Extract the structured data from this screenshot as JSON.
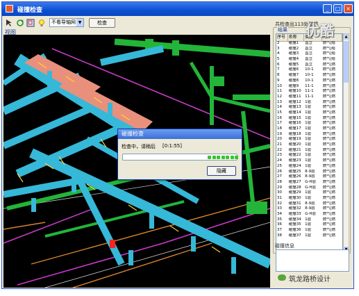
{
  "window": {
    "title": "碰撞检查",
    "minimize": "_",
    "maximize": "□",
    "close": "×"
  },
  "toolbar": {
    "select_value": "不看导轴网",
    "button_label": "检查",
    "view_label": "视图"
  },
  "dialog": {
    "title": "碰撞检查",
    "message": "检查中，请稍后",
    "elapsed": "[0:1:55]",
    "progress_blocks": 7,
    "button_label": "隐藏"
  },
  "results_panel": {
    "title": "共检查出113处碰撞",
    "group_label": "结果",
    "columns": [
      "序号",
      "名称",
      "类型",
      "构件"
    ],
    "rows": [
      [
        "2",
        "碰撞1",
        "直立",
        "燃气|给"
      ],
      [
        "3",
        "碰撞2",
        "直立",
        "燃气|给"
      ],
      [
        "4",
        "碰撞3",
        "直立",
        "燃气|给"
      ],
      [
        "5",
        "碰撞4",
        "直立",
        "燃气|给"
      ],
      [
        "6",
        "碰撞5",
        "直立",
        "燃气|燃"
      ],
      [
        "7",
        "碰撞6",
        "10-1",
        "燃气|燃"
      ],
      [
        "8",
        "碰撞7",
        "10-1",
        "燃气|燃"
      ],
      [
        "9",
        "碰撞8",
        "10-1",
        "燃气|燃"
      ],
      [
        "10",
        "碰撞9",
        "11-1",
        "燃气|燃"
      ],
      [
        "11",
        "碰撞10",
        "11-1",
        "燃气|燃"
      ],
      [
        "12",
        "碰撞11",
        "11-1",
        "燃气|燃"
      ],
      [
        "13",
        "碰撞12",
        "1层",
        "燃气|燃"
      ],
      [
        "14",
        "碰撞13",
        "1层",
        "燃气|燃"
      ],
      [
        "15",
        "碰撞14",
        "1层",
        "燃气|燃"
      ],
      [
        "16",
        "碰撞15",
        "1层",
        "燃气|燃"
      ],
      [
        "17",
        "碰撞16",
        "1层",
        "燃气|燃"
      ],
      [
        "18",
        "碰撞17",
        "1层",
        "燃气|燃"
      ],
      [
        "19",
        "碰撞18",
        "1层",
        "燃气|燃"
      ],
      [
        "20",
        "碰撞19",
        "1层",
        "燃气|燃"
      ],
      [
        "21",
        "碰撞20",
        "1层",
        "燃气|燃"
      ],
      [
        "22",
        "碰撞21",
        "1层",
        "燃气|燃"
      ],
      [
        "23",
        "碰撞22",
        "1层",
        "燃气|燃"
      ],
      [
        "24",
        "碰撞23",
        "1层",
        "燃气|燃"
      ],
      [
        "25",
        "碰撞24",
        "1层",
        "燃气|燃"
      ],
      [
        "26",
        "碰撞25",
        "8-9层",
        "燃气|燃"
      ],
      [
        "27",
        "碰撞26",
        "8-9层",
        "燃气|燃"
      ],
      [
        "28",
        "碰撞27",
        "G-H层",
        "燃气|燃"
      ],
      [
        "29",
        "碰撞28",
        "G-H层",
        "燃气|燃"
      ],
      [
        "30",
        "碰撞29",
        "1层",
        "燃气|燃"
      ],
      [
        "31",
        "碰撞30",
        "1层",
        "燃气|燃"
      ],
      [
        "32",
        "碰撞31",
        "8-9层",
        "燃气|燃"
      ],
      [
        "33",
        "碰撞32",
        "8-9层",
        "燃气|燃"
      ],
      [
        "34",
        "碰撞33",
        "G-H层",
        "燃气|燃"
      ],
      [
        "35",
        "碰撞34",
        "1层",
        "燃气|燃"
      ],
      [
        "36",
        "碰撞35",
        "1层",
        "燃气|燃"
      ],
      [
        "37",
        "碰撞36",
        "1层",
        "燃气|燃"
      ],
      [
        "38",
        "碰撞37",
        "1层",
        "燃气|燃"
      ]
    ],
    "info_label": "碰撞信息"
  },
  "watermark": "优酷",
  "brand": "筑龙路桥设计",
  "colors": {
    "duct": "#36b8d8",
    "pipe_green": "#22b53a",
    "highlight": "#e8907c",
    "magenta": "#c93ac8",
    "orange": "#d9842b"
  }
}
